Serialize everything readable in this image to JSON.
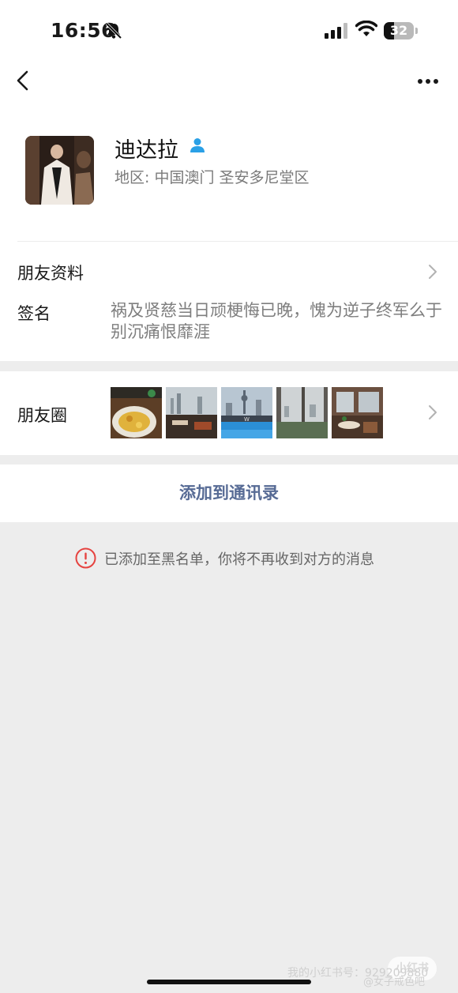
{
  "status_bar": {
    "time": "16:56",
    "battery_level": "32",
    "icons": [
      "bell-muted-icon",
      "signal-icon",
      "wifi-icon",
      "battery-icon"
    ]
  },
  "nav": {
    "icons": [
      "back-chevron-icon",
      "more-dots-icon"
    ]
  },
  "profile": {
    "name": "迪达拉",
    "region": "地区: 中国澳门 圣安多尼堂区",
    "icons": [
      "person-contact-icon"
    ]
  },
  "rows": {
    "friend_info_label": "朋友资料",
    "signature_label": "签名",
    "signature_text": "祸及贤慈当日顽梗悔已晚，愧为逆子终军么于别沉痛恨靡涯",
    "moments_label": "朋友圈"
  },
  "actions": {
    "add_contact": "添加到通讯录"
  },
  "notice": {
    "blacklist_message": "已添加至黑名单，你将不再收到对方的消息"
  },
  "watermark": {
    "app_logo": "小红书",
    "line1": "我的小红书号：929209880",
    "line2": "@女子戒色吧"
  },
  "colors": {
    "link_blue": "#576b95",
    "warning_red": "#e64340",
    "verified_blue": "#2aa0e6",
    "background": "#ededed"
  }
}
